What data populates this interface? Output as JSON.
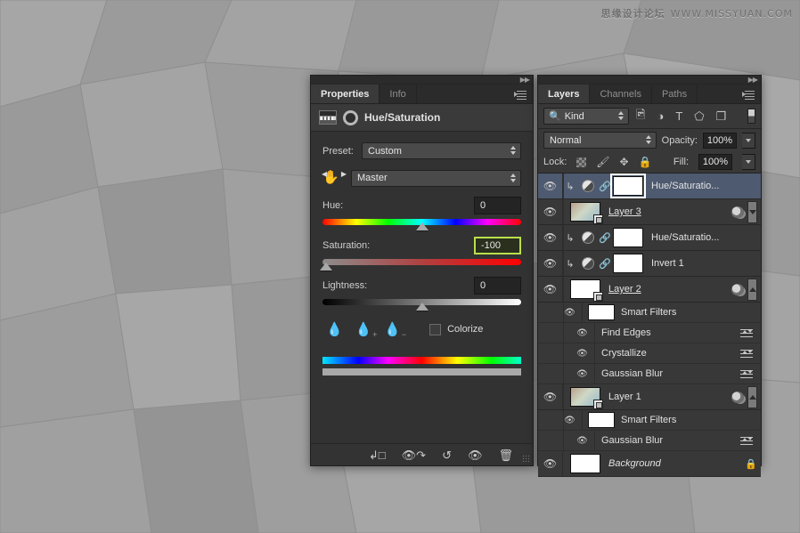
{
  "watermark": {
    "cn": "思缘设计论坛",
    "url": "WWW.MISSYUAN.COM"
  },
  "properties_panel": {
    "tabs": [
      {
        "label": "Properties",
        "active": true
      },
      {
        "label": "Info",
        "active": false
      }
    ],
    "header_title": "Hue/Saturation",
    "preset_label": "Preset:",
    "preset_value": "Custom",
    "channel_value": "Master",
    "sliders": [
      {
        "label": "Hue:",
        "value": "0",
        "thumb_pct": 50,
        "highlight": false
      },
      {
        "label": "Saturation:",
        "value": "-100",
        "thumb_pct": 2,
        "highlight": true
      },
      {
        "label": "Lightness:",
        "value": "0",
        "thumb_pct": 50,
        "highlight": false
      }
    ],
    "eyedroppers": [
      "eyedropper",
      "eyedropper-plus",
      "eyedropper-minus"
    ],
    "colorize_label": "Colorize",
    "colorize_checked": false,
    "footer_icons": [
      "clip-to-layer",
      "view-previous-state",
      "reset",
      "toggle-visibility",
      "delete"
    ]
  },
  "layers_panel": {
    "tabs": [
      {
        "label": "Layers",
        "active": true
      },
      {
        "label": "Channels",
        "active": false
      },
      {
        "label": "Paths",
        "active": false
      }
    ],
    "filter_kind": "Kind",
    "filter_icons": [
      "pixel-layers",
      "adjustment-layers",
      "type-layers",
      "shape-layers",
      "smart-objects"
    ],
    "blend_mode": "Normal",
    "opacity_label": "Opacity:",
    "opacity_value": "100%",
    "lock_label": "Lock:",
    "lock_icons": [
      "lock-transparent-pixels",
      "lock-image-pixels",
      "lock-position",
      "lock-all"
    ],
    "fill_label": "Fill:",
    "fill_value": "100%",
    "rows": [
      {
        "type": "adjustment",
        "name": "Hue/Saturatio...",
        "selected": true,
        "visible": true,
        "clipped": true
      },
      {
        "type": "smart",
        "name": "Layer 3",
        "selected": false,
        "visible": true,
        "underline": true,
        "has_filters_icon": true,
        "has_collapse": true
      },
      {
        "type": "adjustment",
        "name": "Hue/Saturatio...",
        "selected": false,
        "visible": true,
        "clipped": true
      },
      {
        "type": "adjustment",
        "name": "Invert 1",
        "selected": false,
        "visible": true,
        "clipped": true
      },
      {
        "type": "smart",
        "name": "Layer 2",
        "selected": false,
        "visible": true,
        "underline": true,
        "white_thumb": true,
        "has_filters_icon": true,
        "has_scroll": true
      },
      {
        "type": "smartfilters-head",
        "name": "Smart Filters",
        "visible": true
      },
      {
        "type": "filter",
        "name": "Find Edges",
        "visible": true
      },
      {
        "type": "filter",
        "name": "Crystallize",
        "visible": true
      },
      {
        "type": "filter",
        "name": "Gaussian Blur",
        "visible": true
      },
      {
        "type": "smart",
        "name": "Layer 1",
        "selected": false,
        "visible": true,
        "has_filters_icon": true,
        "has_scroll": true
      },
      {
        "type": "smartfilters-head",
        "name": "Smart Filters",
        "visible": true
      },
      {
        "type": "filter",
        "name": "Gaussian Blur",
        "visible": true
      },
      {
        "type": "background",
        "name": "Background",
        "visible": true,
        "locked": true
      }
    ]
  },
  "colors": {
    "panel_bg": "#323232",
    "row_bg": "#383838",
    "selected_row": "#4e5a70",
    "highlight_border": "#b9e04a",
    "text": "#e2e2e2"
  }
}
